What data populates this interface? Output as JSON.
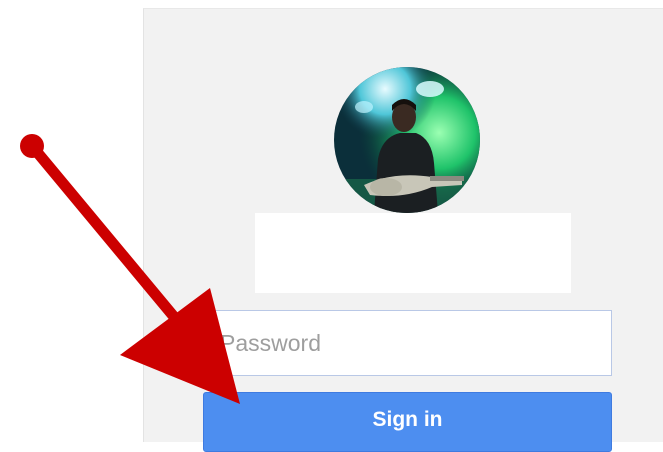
{
  "signin_form": {
    "password_placeholder": "Password",
    "signin_label": "Sign in"
  },
  "colors": {
    "panel_background": "#f2f2f2",
    "primary_button": "#4d8ef0",
    "annotation_arrow": "#cc0000"
  },
  "icons": {
    "avatar": "profile-photo-guitarist",
    "annotation": "red-arrow"
  }
}
